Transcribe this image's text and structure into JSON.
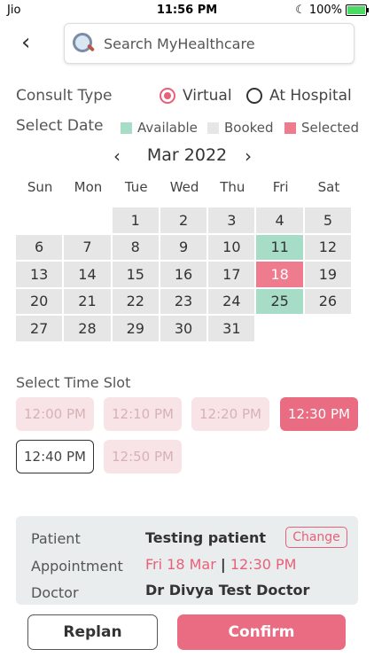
{
  "status_bar": {
    "carrier": "Jio",
    "time": "11:56 PM",
    "battery": "100%"
  },
  "header": {
    "search_placeholder": "Search MyHealthcare"
  },
  "consult": {
    "label": "Consult Type",
    "options": [
      {
        "label": "Virtual",
        "selected": true
      },
      {
        "label": "At Hospital",
        "selected": false
      }
    ]
  },
  "date": {
    "label": "Select Date",
    "legend": {
      "available": "Available",
      "booked": "Booked",
      "selected": "Selected"
    },
    "month": "Mar 2022",
    "weekdays": [
      "Sun",
      "Mon",
      "Tue",
      "Wed",
      "Thu",
      "Fri",
      "Sat"
    ],
    "days": [
      {
        "d": "",
        "s": "empty"
      },
      {
        "d": "",
        "s": "empty"
      },
      {
        "d": "1",
        "s": "booked"
      },
      {
        "d": "2",
        "s": "booked"
      },
      {
        "d": "3",
        "s": "booked"
      },
      {
        "d": "4",
        "s": "booked"
      },
      {
        "d": "5",
        "s": "booked"
      },
      {
        "d": "6",
        "s": "booked"
      },
      {
        "d": "7",
        "s": "booked"
      },
      {
        "d": "8",
        "s": "booked"
      },
      {
        "d": "9",
        "s": "booked"
      },
      {
        "d": "10",
        "s": "booked"
      },
      {
        "d": "11",
        "s": "available"
      },
      {
        "d": "12",
        "s": "booked"
      },
      {
        "d": "13",
        "s": "booked"
      },
      {
        "d": "14",
        "s": "booked"
      },
      {
        "d": "15",
        "s": "booked"
      },
      {
        "d": "16",
        "s": "booked"
      },
      {
        "d": "17",
        "s": "booked"
      },
      {
        "d": "18",
        "s": "selected"
      },
      {
        "d": "19",
        "s": "booked"
      },
      {
        "d": "20",
        "s": "booked"
      },
      {
        "d": "21",
        "s": "booked"
      },
      {
        "d": "22",
        "s": "booked"
      },
      {
        "d": "23",
        "s": "booked"
      },
      {
        "d": "24",
        "s": "booked"
      },
      {
        "d": "25",
        "s": "available"
      },
      {
        "d": "26",
        "s": "booked"
      },
      {
        "d": "27",
        "s": "booked"
      },
      {
        "d": "28",
        "s": "booked"
      },
      {
        "d": "29",
        "s": "booked"
      },
      {
        "d": "30",
        "s": "booked"
      },
      {
        "d": "31",
        "s": "booked"
      }
    ]
  },
  "time": {
    "label": "Select Time Slot",
    "slots": [
      {
        "t": "12:00 PM",
        "s": "disabled"
      },
      {
        "t": "12:10 PM",
        "s": "disabled"
      },
      {
        "t": "12:20 PM",
        "s": "disabled"
      },
      {
        "t": "12:30 PM",
        "s": "active"
      },
      {
        "t": "12:40 PM",
        "s": "outlined"
      },
      {
        "t": "12:50 PM",
        "s": "disabled"
      }
    ]
  },
  "summary": {
    "patient_label": "Patient",
    "patient": "Testing patient",
    "change": "Change",
    "appointment_label": "Appointment",
    "appointment_date": "Fri 18 Mar",
    "separator": "|",
    "appointment_time": "12:30 PM",
    "doctor_label": "Doctor",
    "doctor": "Dr Divya Test Doctor"
  },
  "footer": {
    "replan": "Replan",
    "confirm": "Confirm"
  },
  "colors": {
    "accent": "#ea6c82",
    "available": "#a7dcc6",
    "booked": "#e6e6e6",
    "summary_bg": "#e9eded"
  }
}
